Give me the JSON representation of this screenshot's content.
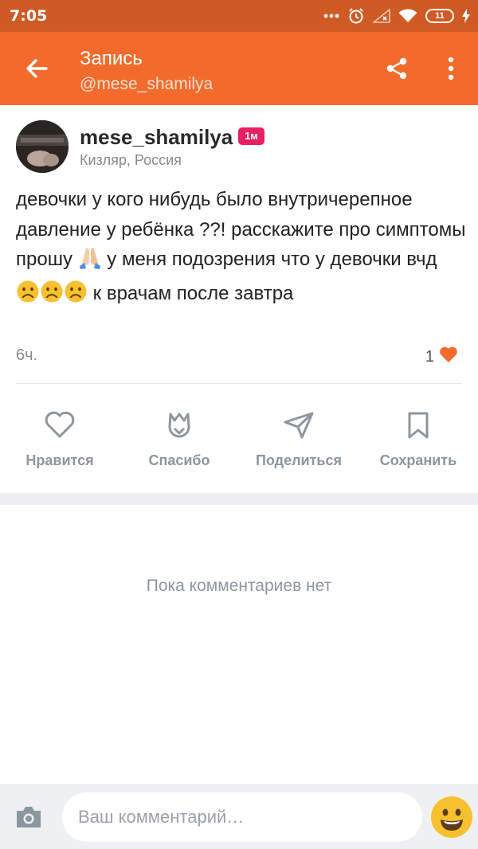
{
  "status_bar": {
    "time": "7:05",
    "battery": "11"
  },
  "header": {
    "title": "Запись",
    "subtitle": "@mese_shamilya"
  },
  "post": {
    "author": {
      "name": "mese_shamilya",
      "badge": "1м",
      "location": "Кизляр, Россия"
    },
    "text_parts": [
      "девочки у кого нибудь было внутричерепное давление у ребёнка ??! расскажите про симптомы прошу ",
      " у меня подозрения что у девочки вчд ",
      " к врачам после завтра"
    ],
    "time": "6ч.",
    "likes_count": "1"
  },
  "actions": [
    {
      "label": "Нравится"
    },
    {
      "label": "Спасибо"
    },
    {
      "label": "Поделиться"
    },
    {
      "label": "Сохранить"
    }
  ],
  "comments": {
    "empty_text": "Пока комментариев нет"
  },
  "comment_bar": {
    "placeholder": "Ваш комментарий…"
  },
  "colors": {
    "status_bar": "#d05a24",
    "app_bar": "#f26b2c",
    "badge": "#e91e63",
    "like_heart": "#f26b2c",
    "action_icon": "#8c96a0"
  },
  "icons": [
    "back-arrow-icon",
    "share-icon",
    "more-vert-icon",
    "heart-icon",
    "thanks-tulip-icon",
    "send-icon",
    "bookmark-icon",
    "camera-icon",
    "smiley-icon",
    "praying-hands-emoji",
    "sad-face-emoji"
  ]
}
